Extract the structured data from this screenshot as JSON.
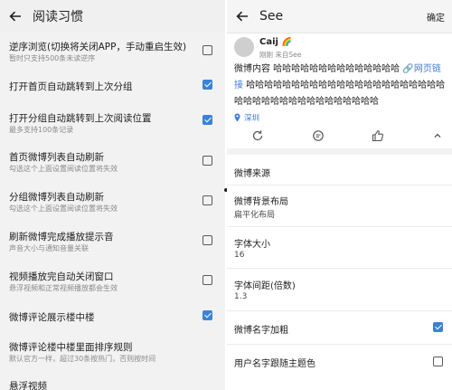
{
  "left": {
    "title": "阅读习惯",
    "settings": [
      {
        "title": "逆序浏览(切换将关闭APP，手动重启生效)",
        "subtitle": "暂时只支持500条未读逆序",
        "checked": false
      },
      {
        "title": "打开首页自动跳转到上次分组",
        "subtitle": "",
        "checked": true
      },
      {
        "title": "打开分组自动跳转到上次阅读位置",
        "subtitle": "最多支持100条记录",
        "checked": true
      },
      {
        "title": "首页微博列表自动刷新",
        "subtitle": "勾选这个上面设置阅读位置将失效",
        "checked": false
      },
      {
        "title": "分组微博列表自动刷新",
        "subtitle": "勾选这个上面设置阅读位置将失效",
        "checked": false
      },
      {
        "title": "刷新微博完成播放提示音",
        "subtitle": "声音大小与通知音量关联",
        "checked": false
      },
      {
        "title": "视频播放完自动关闭窗口",
        "subtitle": "悬浮视频和正常视频播放都会生效",
        "checked": false
      },
      {
        "title": "微博评论展示楼中楼",
        "subtitle": "",
        "checked": true
      },
      {
        "title": "微博评论楼中楼里面排序规则",
        "subtitle": "默认官方一样，超过30条按热门，否则按时间",
        "checked": null
      },
      {
        "title": "悬浮视频",
        "subtitle": "",
        "checked": null
      }
    ]
  },
  "right": {
    "title": "See",
    "confirm": "确定",
    "post": {
      "name": "Caij",
      "name_badge": "🌈",
      "meta": "刚刚 来自See",
      "content": "微博内容 哈哈哈哈哈哈哈哈哈哈哈哈哈哈",
      "link_text": "网页链接",
      "content2": "哈哈哈哈哈哈哈哈哈哈哈哈哈哈哈哈哈哈哈哈哈哈哈哈哈哈哈哈哈哈哈哈哈哈哈哈哈哈",
      "location": "深圳"
    },
    "rows": [
      {
        "title": "微博来源",
        "value": ""
      },
      {
        "title": "微博背景布局",
        "value": "扁平化布局"
      },
      {
        "title": "字体大小",
        "value": "16"
      },
      {
        "title": "字体间距(倍数)",
        "value": "1.3"
      },
      {
        "title": "微博名字加粗",
        "value": "",
        "checked": true
      },
      {
        "title": "用户名字跟随主题色",
        "value": "",
        "checked": false
      }
    ]
  },
  "colors": {
    "accent": "#3b82d6",
    "link": "#3b7dd8"
  }
}
